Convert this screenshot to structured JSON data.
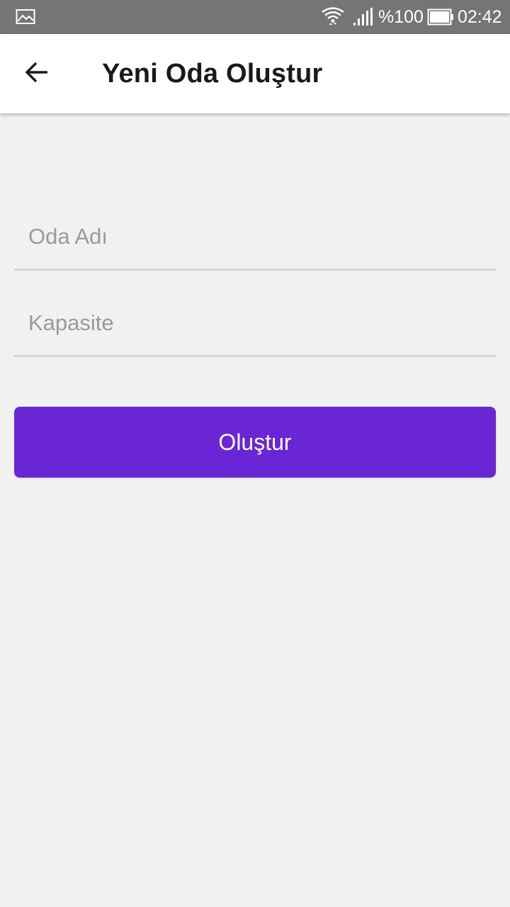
{
  "status_bar": {
    "battery_percent": "%100",
    "time": "02:42",
    "icons": [
      "gallery-icon",
      "wifi-icon",
      "signal-icon",
      "battery-icon"
    ]
  },
  "app_bar": {
    "title": "Yeni Oda Oluştur",
    "back_icon": "arrow-left-icon"
  },
  "form": {
    "room_name": {
      "placeholder": "Oda Adı",
      "value": ""
    },
    "capacity": {
      "placeholder": "Kapasite",
      "value": ""
    },
    "submit_label": "Oluştur"
  },
  "colors": {
    "status_bar_bg": "#757575",
    "app_bar_bg": "#ffffff",
    "page_bg": "#f1f1f1",
    "accent": "#6a26d4",
    "placeholder": "#9a9a9a",
    "divider": "#d4d4d4"
  }
}
